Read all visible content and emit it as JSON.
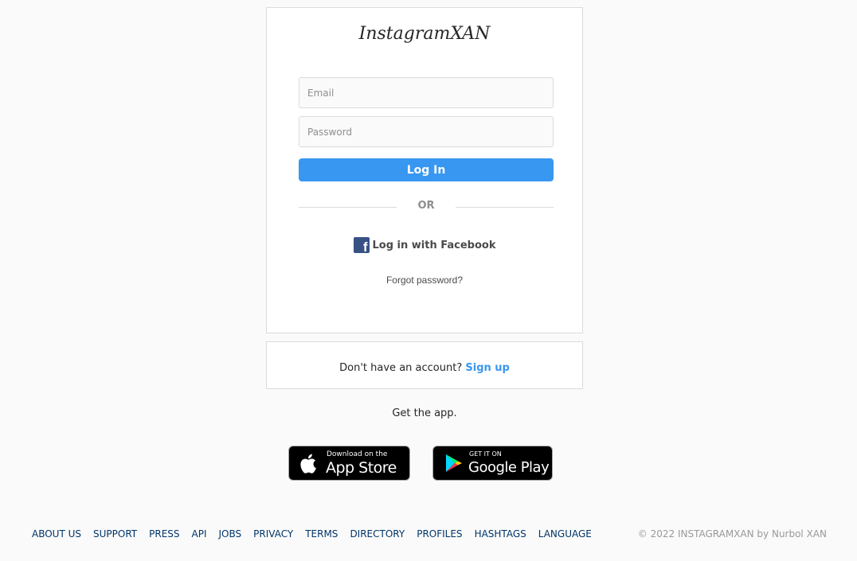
{
  "brand": {
    "logo_text": "InstagramXAN"
  },
  "login": {
    "email_placeholder": "Email",
    "password_placeholder": "Password",
    "login_button": "Log In",
    "divider_text": "OR",
    "facebook_label": "Log in with Facebook",
    "forgot_password": "Forgot password?"
  },
  "signup": {
    "prompt": "Don't have an account?",
    "link": "Sign up"
  },
  "get_app": {
    "label": "Get the app.",
    "app_store": {
      "small": "Download on the",
      "big": "App Store"
    },
    "google_play": {
      "small": "GET IT ON",
      "big": "Google Play"
    }
  },
  "footer": {
    "links": [
      "ABOUT US",
      "SUPPORT",
      "PRESS",
      "API",
      "JOBS",
      "PRIVACY",
      "TERMS",
      "DIRECTORY",
      "PROFILES",
      "HASHTAGS",
      "LANGUAGE"
    ],
    "copyright": "© 2022 INSTAGRAMXAN by Nurbol XAN"
  },
  "colors": {
    "accent": "#3897f0",
    "facebook": "#385185",
    "footer_link": "#003569",
    "background": "#fafafa"
  },
  "icons": [
    "facebook-icon",
    "apple-icon",
    "google-play-icon"
  ]
}
